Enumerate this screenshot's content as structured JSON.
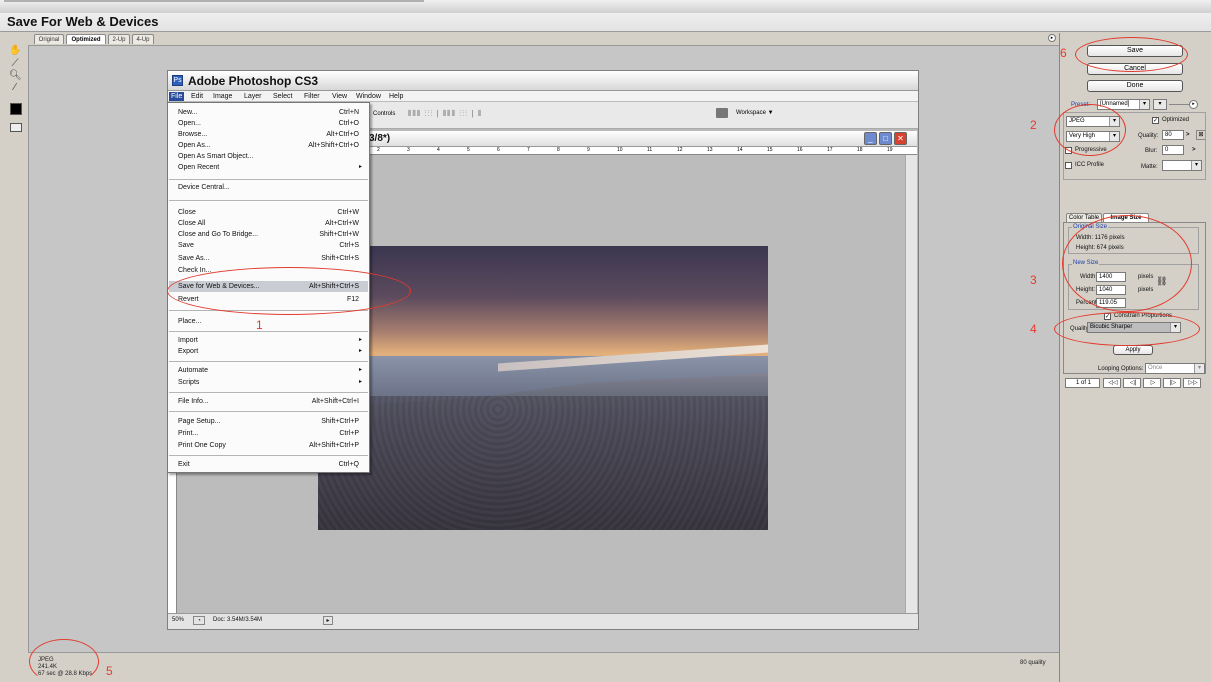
{
  "window": {
    "title": "Save For Web & Devices",
    "view_tabs": [
      "Original",
      "Optimized",
      "2-Up",
      "4-Up"
    ],
    "active_tab": "Optimized"
  },
  "photoshop": {
    "app_title": "Adobe Photoshop CS3",
    "menus": [
      "File",
      "Edit",
      "Image",
      "Layer",
      "Select",
      "Filter",
      "View",
      "Window",
      "Help"
    ],
    "options_bar": {
      "controls_label": "Controls",
      "workspace_label": "Workspace ▼"
    },
    "doc_title": "3/8*)",
    "doc_status": {
      "zoom": "50%",
      "doc_size": "Doc: 3.54M/3.54M"
    },
    "ruler_numbers": [
      "2",
      "3",
      "4",
      "5",
      "6",
      "7",
      "8",
      "9",
      "10",
      "11",
      "12",
      "13",
      "14",
      "15",
      "16",
      "17",
      "18",
      "19"
    ]
  },
  "file_menu": {
    "items": [
      {
        "label": "New...",
        "shortcut": "Ctrl+N"
      },
      {
        "label": "Open...",
        "shortcut": "Ctrl+O"
      },
      {
        "label": "Browse...",
        "shortcut": "Alt+Ctrl+O"
      },
      {
        "label": "Open As...",
        "shortcut": "Alt+Shift+Ctrl+O"
      },
      {
        "label": "Open As Smart Object...",
        "shortcut": ""
      },
      {
        "label": "Open Recent",
        "shortcut": "▸"
      },
      {
        "label": "Device Central...",
        "shortcut": ""
      },
      {
        "label": "Close",
        "shortcut": "Ctrl+W"
      },
      {
        "label": "Close All",
        "shortcut": "Alt+Ctrl+W"
      },
      {
        "label": "Close and Go To Bridge...",
        "shortcut": "Shift+Ctrl+W"
      },
      {
        "label": "Save",
        "shortcut": "Ctrl+S"
      },
      {
        "label": "Save As...",
        "shortcut": "Shift+Ctrl+S"
      },
      {
        "label": "Check In...",
        "shortcut": ""
      },
      {
        "label": "Save for Web & Devices...",
        "shortcut": "Alt+Shift+Ctrl+S"
      },
      {
        "label": "Revert",
        "shortcut": "F12"
      },
      {
        "label": "Place...",
        "shortcut": ""
      },
      {
        "label": "Import",
        "shortcut": "▸"
      },
      {
        "label": "Export",
        "shortcut": "▸"
      },
      {
        "label": "Automate",
        "shortcut": "▸"
      },
      {
        "label": "Scripts",
        "shortcut": "▸"
      },
      {
        "label": "File Info...",
        "shortcut": "Alt+Shift+Ctrl+I"
      },
      {
        "label": "Page Setup...",
        "shortcut": "Shift+Ctrl+P"
      },
      {
        "label": "Print...",
        "shortcut": "Ctrl+P"
      },
      {
        "label": "Print One Copy",
        "shortcut": "Alt+Shift+Ctrl+P"
      },
      {
        "label": "Exit",
        "shortcut": "Ctrl+Q"
      }
    ],
    "highlighted": "Save for Web & Devices..."
  },
  "right_panel": {
    "buttons": {
      "save": "Save",
      "cancel": "Cancel",
      "done": "Done"
    },
    "preset_label": "Preset:",
    "preset_value": "[Unnamed]",
    "format": "JPEG",
    "quality_preset": "Very High",
    "optimized_label": "Optimized",
    "quality_label": "Quality:",
    "quality_value": "80",
    "progressive_label": "Progressive",
    "blur_label": "Blur:",
    "blur_value": "0",
    "icc_label": "ICC Profile",
    "matte_label": "Matte:",
    "tabs": [
      "Color Table",
      "Image Size"
    ],
    "active_tab": "Image Size",
    "original_size": {
      "title": "Original Size",
      "width": "Width: 1176 pixels",
      "height": "Height: 674 pixels"
    },
    "new_size": {
      "title": "New Size",
      "width_label": "Width:",
      "width_value": "1400",
      "width_unit": "pixels",
      "height_label": "Height:",
      "height_value": "1040",
      "height_unit": "pixels",
      "percent_label": "Percent:",
      "percent_value": "119.05"
    },
    "constrain_label": "Constrain Proportions",
    "quality_resample_label": "Quality:",
    "quality_resample_value": "Bicubic Sharper",
    "apply_label": "Apply",
    "looping_label": "Looping Options:",
    "looping_value": "Once",
    "frame_counter": "1 of 1",
    "playback_buttons": [
      "◁◁",
      "◁|",
      "▷",
      "|▷",
      "▷▷"
    ]
  },
  "status": {
    "format": "JPEG",
    "size": "241.4K",
    "time": "67 sec @ 28.8 Kbps",
    "quality": "80 quality"
  },
  "annotations": [
    "1",
    "2",
    "3",
    "4",
    "5",
    "6"
  ],
  "colors": {
    "annotation": "#e23b2e",
    "menu_highlight": "#c9ccd3",
    "panel_bg": "#d4d0c8"
  }
}
